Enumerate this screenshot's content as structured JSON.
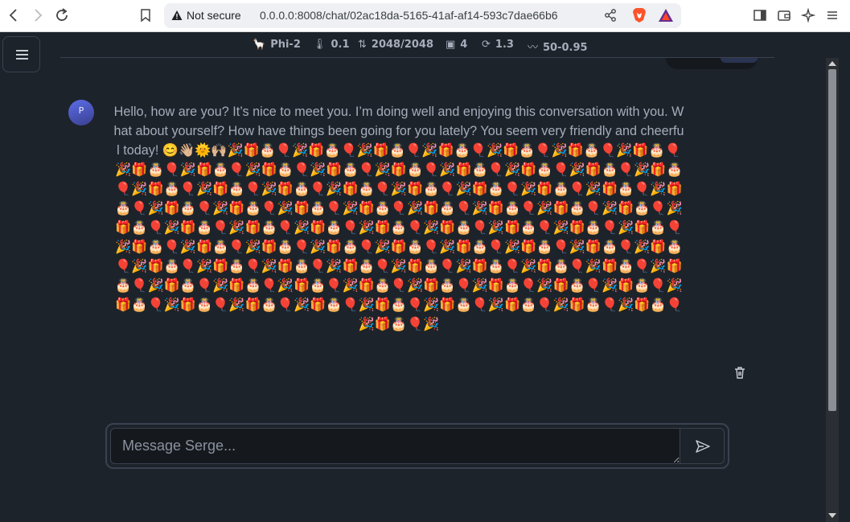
{
  "browser": {
    "security_label": "Not secure",
    "url": "0.0.0.0:8008/chat/02ac18da-5165-41af-af14-593c7dae66b6"
  },
  "stats": {
    "model": "Phi-2",
    "temperature": "0.1",
    "context": "2048/2048",
    "threads": "4",
    "repeat_penalty": "1.3",
    "top_k_p": "50-0.95"
  },
  "message": {
    "avatar_initial": "P",
    "text": "Hello, how are you? It’s nice to meet you. I’m doing well and enjoying this conversation with you. What about yourself? How have things been going for you lately? You seem very friendly and cheerful today! 😊👋🏼🌞🙌🏼🎉🎁🎂🎈🎉🎁🎂🎈🎉🎁🎂🎈🎉🎁🎂🎈🎉🎁🎂🎈🎉🎁🎂🎈🎉🎁🎂🎈🎉🎁🎂🎈🎉🎁🎂🎈🎉🎁🎂🎈🎉🎁🎂🎈🎉🎁🎂🎈🎉🎁🎂🎈🎉🎁🎂🎈🎉🎁🎂🎈🎉🎁🎂🎈🎉🎁🎂🎈🎉🎁🎂🎈🎉🎁🎂🎈🎉🎁🎂🎈🎉🎁🎂🎈🎉🎁🎂🎈🎉🎁🎂🎈🎉🎁🎂🎈🎉🎁🎂🎈🎉🎁🎂🎈🎉🎁🎂🎈🎉🎁🎂🎈🎉🎁🎂🎈🎉🎁🎂🎈🎉🎁🎂🎈🎉🎁🎂🎈🎉🎁🎂🎈🎉🎁🎂🎈🎉🎁🎂🎈🎉🎁🎂🎈🎉🎁🎂🎈🎉🎁🎂🎈🎉🎁🎂🎈🎉🎁🎂🎈🎉🎁🎂🎈🎉🎁🎂🎈🎉🎁🎂🎈🎉🎁🎂🎈🎉🎁🎂🎈🎉🎁🎂🎈🎉🎁🎂🎈🎉🎁🎂🎈🎉🎁🎂🎈🎉🎁🎂🎈🎉🎁🎂🎈🎉🎁🎂🎈🎉🎁🎂🎈🎉🎁🎂🎈🎉🎁🎂🎈🎉🎁🎂🎈🎉🎁🎂🎈🎉🎁🎂🎈🎉🎁🎂🎈🎉🎁🎂🎈🎉🎁🎂🎈🎉🎁🎂🎈🎉🎁🎂🎈🎉🎁🎂🎈🎉🎁🎂🎈🎉🎁🎂🎈🎉🎁🎂🎈🎉🎁🎂🎈🎉🎁🎂🎈🎉🎁🎂🎈🎉🎁🎂🎈🎉🎁🎂🎈🎉🎁🎂🎈🎉🎁🎂🎈🎉🎁🎂🎈🎉🎁🎂🎈🎉🎁🎂🎈🎉🎁🎂🎈🎉"
  },
  "composer": {
    "placeholder": "Message Serge..."
  },
  "colors": {
    "background": "#1d232a",
    "text": "#a6adbb",
    "border": "#3a4250",
    "avatar": "#5b6ee8"
  }
}
